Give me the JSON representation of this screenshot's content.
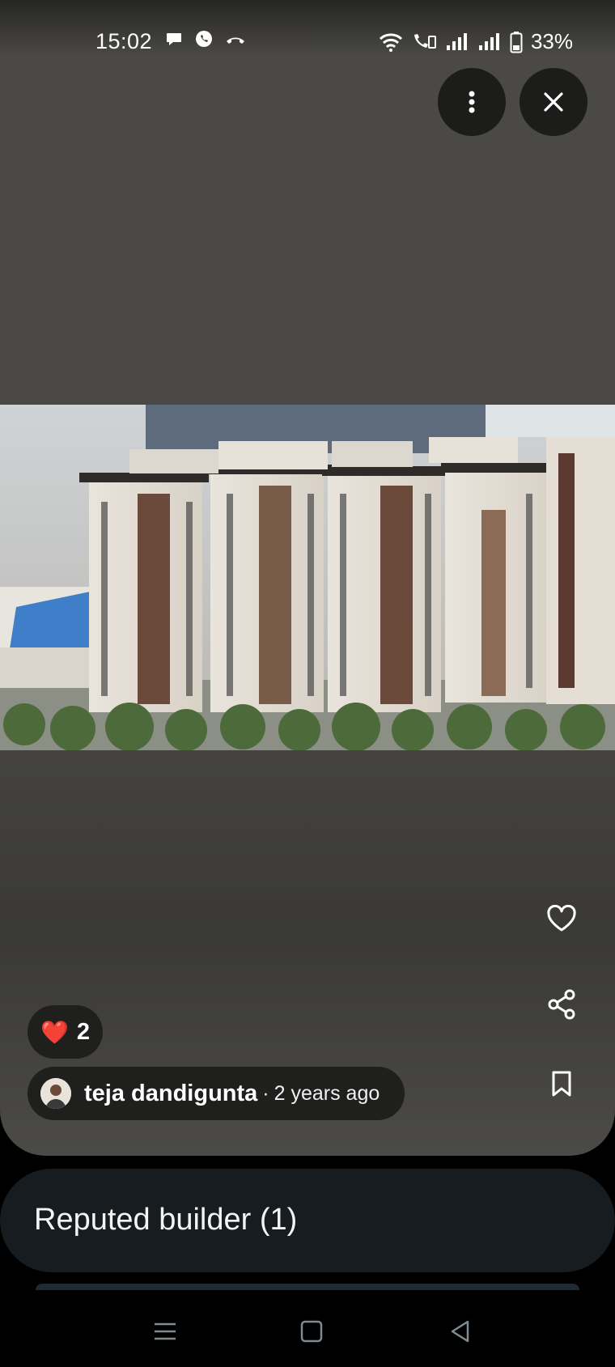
{
  "status_bar": {
    "time": "15:02",
    "battery": "33%",
    "left_icons": [
      "chat-bubble-icon",
      "whatsapp-icon",
      "missed-call-icon"
    ],
    "right_icons": [
      "wifi-icon",
      "vowifi-call-icon",
      "signal-icon",
      "signal-icon",
      "battery-icon"
    ]
  },
  "viewer": {
    "more_icon": "more-vertical-icon",
    "close_icon": "close-icon",
    "photo_alt": "Architectural scale model of residential towers",
    "actions": [
      "heart-icon",
      "share-icon",
      "bookmark-icon"
    ]
  },
  "reactions": {
    "emoji": "❤️",
    "count": "2"
  },
  "author": {
    "name": "teja dandigunta",
    "separator": "·",
    "time_ago": "2 years ago"
  },
  "bottom_card": {
    "label": "Reputed builder (1)"
  },
  "nav": {
    "icons": [
      "recents-icon",
      "home-icon",
      "back-icon"
    ]
  }
}
